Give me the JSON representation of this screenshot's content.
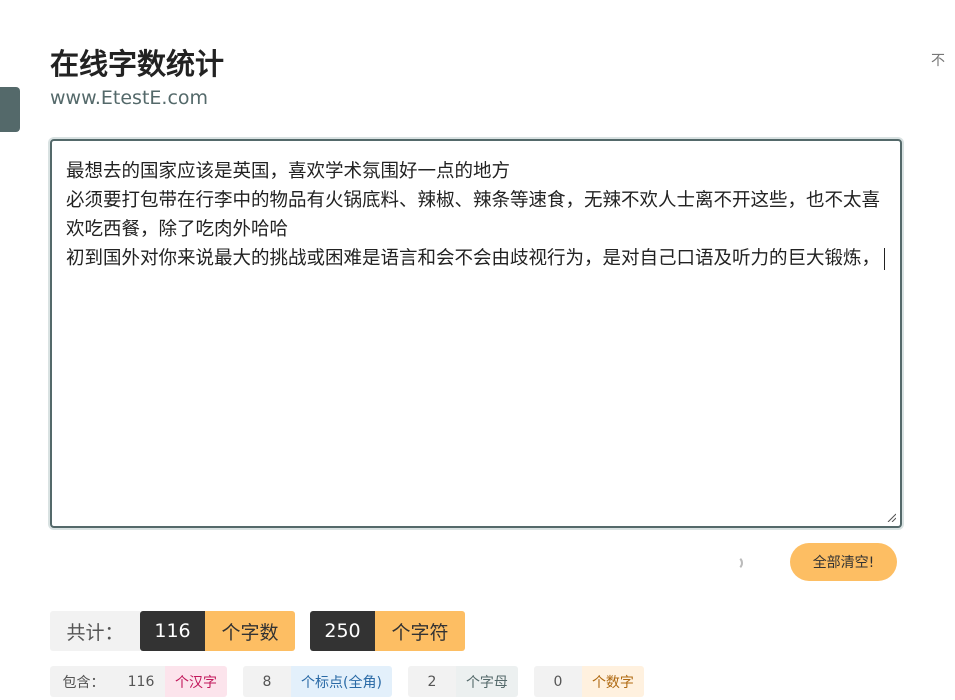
{
  "header": {
    "title": "在线字数统计",
    "subtitle": "www.EtestE.com",
    "top_right_text": "不"
  },
  "editor": {
    "lines": [
      "最想去的国家应该是英国，喜欢学术氛围好一点的地方",
      "必须要打包带在行李中的物品有火锅底料、辣椒、辣条等速食，无辣不欢人士离不开这些，也不太喜欢吃西餐，除了吃肉外哈哈",
      "初到国外对你来说最大的挑战或困难是语言和会不会由歧视行为，是对自己口语及听力的巨大锻炼，"
    ]
  },
  "actions": {
    "clear_label": "全部清空!"
  },
  "totals": {
    "label": "共计：",
    "chars_value": "116",
    "chars_unit": "个字数",
    "symbols_value": "250",
    "symbols_unit": "个字符"
  },
  "breakdown": {
    "label": "包含：",
    "items": [
      {
        "value": "116",
        "unit": "个汉字"
      },
      {
        "value": "8",
        "unit": "个标点(全角)"
      },
      {
        "value": "2",
        "unit": "个字母"
      },
      {
        "value": "0",
        "unit": "个数字"
      }
    ]
  },
  "colors": {
    "accent": "#54696a",
    "button": "#fdbe63",
    "dark": "#333333"
  }
}
